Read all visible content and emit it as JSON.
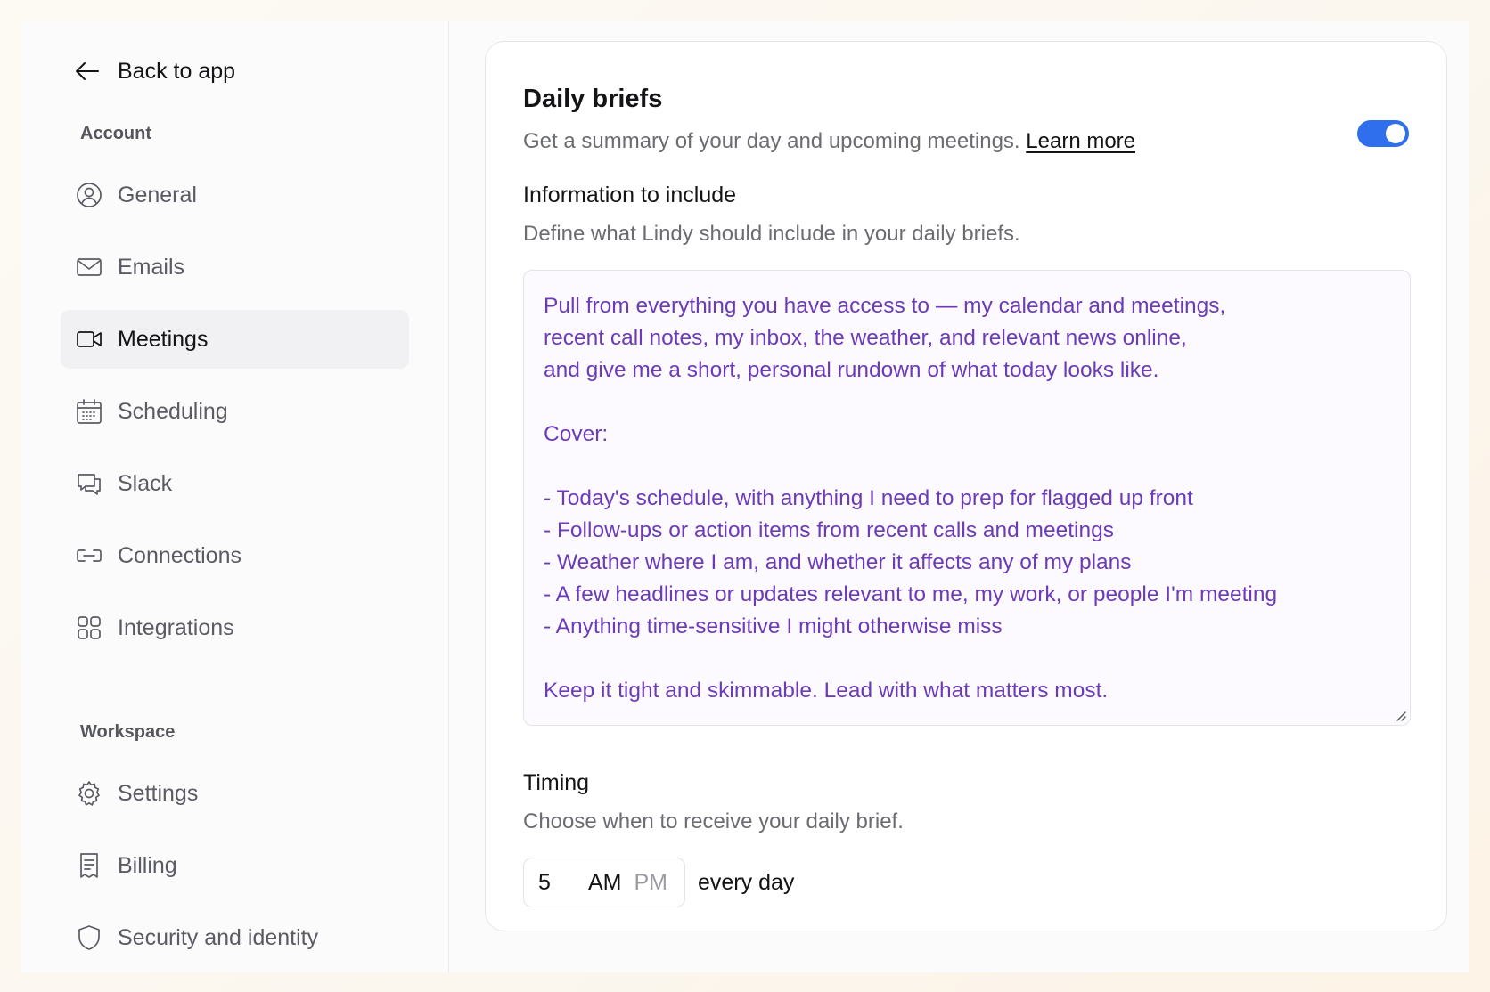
{
  "sidebar": {
    "back_label": "Back to app",
    "account_label": "Account",
    "account_items": [
      {
        "label": "General",
        "icon": "user-circle-icon"
      },
      {
        "label": "Emails",
        "icon": "mail-icon"
      },
      {
        "label": "Meetings",
        "icon": "video-icon",
        "active": true
      },
      {
        "label": "Scheduling",
        "icon": "calendar-icon"
      },
      {
        "label": "Slack",
        "icon": "chat-icon"
      },
      {
        "label": "Connections",
        "icon": "link-icon"
      },
      {
        "label": "Integrations",
        "icon": "grid-icon"
      }
    ],
    "workspace_label": "Workspace",
    "workspace_items": [
      {
        "label": "Settings",
        "icon": "gear-icon"
      },
      {
        "label": "Billing",
        "icon": "receipt-icon"
      },
      {
        "label": "Security and identity",
        "icon": "shield-icon"
      }
    ]
  },
  "brief": {
    "title": "Daily briefs",
    "description": "Get a summary of your day and upcoming meetings.",
    "learn_more": "Learn more",
    "enabled": true,
    "toggle_color": "#2f6fed",
    "info_title": "Information to include",
    "info_desc": "Define what Lindy should include in your daily briefs.",
    "info_text": "Pull from everything you have access to — my calendar and meetings,\nrecent call notes, my inbox, the weather, and relevant news online,\nand give me a short, personal rundown of what today looks like.\n\nCover:\n\n- Today's schedule, with anything I need to prep for flagged up front\n- Follow-ups or action items from recent calls and meetings\n- Weather where I am, and whether it affects any of my plans\n- A few headlines or updates relevant to me, my work, or people I'm meeting\n- Anything time-sensitive I might otherwise miss\n\nKeep it tight and skimmable. Lead with what matters most.",
    "text_color": "#6c3bb8",
    "timing_title": "Timing",
    "timing_desc": "Choose when to receive your daily brief.",
    "hour": "5",
    "am_label": "AM",
    "pm_label": "PM",
    "selected_period": "AM",
    "every_day_label": "every day"
  }
}
